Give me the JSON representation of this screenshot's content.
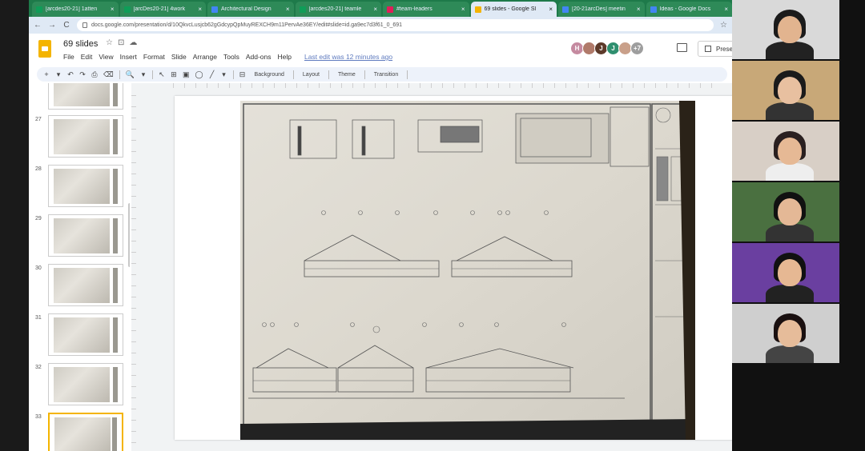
{
  "browser": {
    "tabs": [
      {
        "label": "[arcdes20-21] 1atten",
        "favicon_color": "#0f9d58",
        "active": false
      },
      {
        "label": "[arcDes20-21] 4work",
        "favicon_color": "#0f9d58",
        "active": false
      },
      {
        "label": "Architectural Design",
        "favicon_color": "#4285f4",
        "active": false
      },
      {
        "label": "[arcdes20-21] teamle",
        "favicon_color": "#0f9d58",
        "active": false
      },
      {
        "label": "#team-leaders",
        "favicon_color": "#e01e5a",
        "active": false
      },
      {
        "label": "69 slides - Google Sl",
        "favicon_color": "#f4b400",
        "active": true
      },
      {
        "label": "[20-21arcDes] meetin",
        "favicon_color": "#4285f4",
        "active": false
      },
      {
        "label": "Ideas - Google Docs",
        "favicon_color": "#4285f4",
        "active": false
      }
    ],
    "tab_close": "×",
    "nav": {
      "back": "←",
      "forward": "→",
      "reload": "C"
    },
    "url": "docs.google.com/presentation/d/10QkvcLusjcb62gGdcypQpMuyREXCH9m11PervAe36EY/edit#slide=id.ga9ec7d3f61_0_691",
    "bookmark_star": "☆"
  },
  "app": {
    "title": "69 slides",
    "title_icons": [
      "☆",
      "⊡",
      "☁"
    ],
    "menu": [
      "File",
      "Edit",
      "View",
      "Insert",
      "Format",
      "Slide",
      "Arrange",
      "Tools",
      "Add-ons",
      "Help"
    ],
    "last_edit": "Last edit was 12 minutes ago",
    "avatars": [
      {
        "initial": "H",
        "color": "#c58aa0"
      },
      {
        "initial": "",
        "color": "#b07a6a"
      },
      {
        "initial": "J",
        "color": "#5d3a2a"
      },
      {
        "initial": "J",
        "color": "#2f8f6f"
      },
      {
        "initial": "",
        "color": "#c9a08a"
      },
      {
        "initial": "+7",
        "color": "#9e9e9e"
      }
    ],
    "present_label": "Prese"
  },
  "toolbar": {
    "icons": [
      "+",
      "▾",
      "↶",
      "↷",
      "⎙",
      "⌫",
      "🔍",
      "▾",
      "↖",
      "⊞",
      "▣",
      "◯",
      "╱",
      "▾",
      "⊟"
    ],
    "background_label": "Background",
    "layout_label": "Layout",
    "theme_label": "Theme",
    "transition_label": "Transition"
  },
  "filmstrip": {
    "slides": [
      {
        "number": "",
        "selected": false
      },
      {
        "number": "27",
        "selected": false
      },
      {
        "number": "28",
        "selected": false
      },
      {
        "number": "29",
        "selected": false
      },
      {
        "number": "30",
        "selected": false
      },
      {
        "number": "31",
        "selected": false
      },
      {
        "number": "32",
        "selected": false
      },
      {
        "number": "33",
        "selected": true
      }
    ]
  },
  "video": {
    "participants": [
      {
        "wall": "#d9d9d9",
        "skin": "#e2b48f",
        "hair": "#1b1b1b",
        "shirt": "#222"
      },
      {
        "wall": "#c8a878",
        "skin": "#e8c0a0",
        "hair": "#1b1b1b",
        "shirt": "#333"
      },
      {
        "wall": "#d8cfc6",
        "skin": "#e6b995",
        "hair": "#2a2020",
        "shirt": "#eee"
      },
      {
        "wall": "#4a7040",
        "skin": "#e4b896",
        "hair": "#111",
        "shirt": "#333"
      },
      {
        "wall": "#6a3fa0",
        "skin": "#e6b893",
        "hair": "#111",
        "shirt": "#222"
      },
      {
        "wall": "#cfcfcf",
        "skin": "#e6bc9a",
        "hair": "#1a1010",
        "shirt": "#444"
      }
    ]
  }
}
